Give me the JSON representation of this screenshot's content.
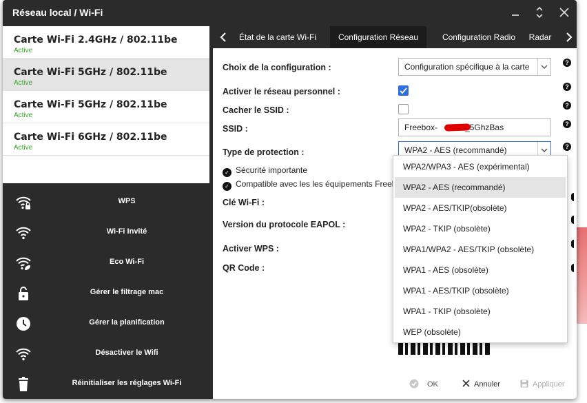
{
  "window": {
    "title": "Réseau local / Wi-Fi"
  },
  "cards": [
    {
      "title": "Carte Wi-Fi 2.4GHz / 802.11be",
      "status": "Active"
    },
    {
      "title": "Carte Wi-Fi 5GHz / 802.11be",
      "status": "Active"
    },
    {
      "title": "Carte Wi-Fi 5GHz / 802.11be",
      "status": "Active"
    },
    {
      "title": "Carte Wi-Fi 6GHz / 802.11be",
      "status": "Active"
    }
  ],
  "actions": [
    {
      "label": "WPS",
      "icon": "wifi-lock-icon"
    },
    {
      "label": "Wi-Fi Invité",
      "icon": "wifi-icon"
    },
    {
      "label": "Eco Wi-Fi",
      "icon": "wifi-eco-icon"
    },
    {
      "label": "Gérer le filtrage mac",
      "icon": "lock-icon"
    },
    {
      "label": "Gérer la planification",
      "icon": "clock-icon"
    },
    {
      "label": "Désactiver le Wifi",
      "icon": "wifi-icon"
    },
    {
      "label": "Réinitialiser les réglages Wi-Fi",
      "icon": "trash-icon"
    }
  ],
  "tabs": [
    {
      "label": "État de la carte Wi-Fi"
    },
    {
      "label": "Configuration Réseau"
    },
    {
      "label": "Configuration Radio"
    },
    {
      "label": "Radar"
    }
  ],
  "form": {
    "config_label": "Choix de la configuration :",
    "config_value": "Configuration spécifique à la carte",
    "enable_label": "Activer le réseau personnel :",
    "hide_ssid_label": "Cacher le SSID :",
    "ssid_label": "SSID :",
    "ssid_prefix": "Freebox-",
    "ssid_suffix": "_5GhzBas",
    "protection_label": "Type de protection :",
    "protection_value": "WPA2 - AES (recommandé)",
    "security_note": "Sécurité importante",
    "compat_note": "Compatible avec les les équipements Freebo",
    "key_label": "Clé Wi-Fi :",
    "eapol_label": "Version du protocole EAPOL :",
    "wps_label": "Activer WPS :",
    "qr_label": "QR Code :",
    "enable_checked": true,
    "hide_ssid_checked": false
  },
  "dropdown_options": [
    "WPA2/WPA3 - AES (expérimental)",
    "WPA2 - AES (recommandé)",
    "WPA2 - AES/TKIP(obsolète)",
    "WPA2 - TKIP (obsolète)",
    "WPA1/WPA2 - AES/TKIP (obsolète)",
    "WPA1 - AES (obsolète)",
    "WPA1 - AES/TKIP (obsolète)",
    "WPA1 - TKIP (obsolète)",
    "WEP (obsolète)"
  ],
  "footer": {
    "ok": "OK",
    "cancel": "Annuler",
    "apply": "Appliquer"
  },
  "colors": {
    "accent": "#2f6fe0",
    "active_status": "#3aa32c",
    "window_bg": "#2b2b2b"
  }
}
